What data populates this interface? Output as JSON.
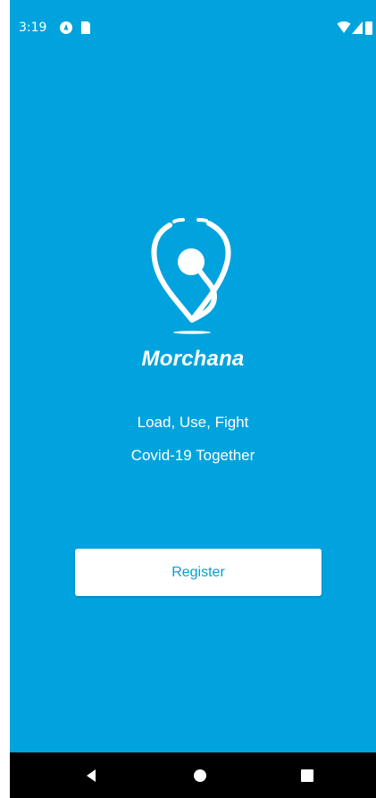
{
  "status": {
    "time": "3:19",
    "icons": [
      "hotspot-icon",
      "sim-card-icon",
      "wifi-icon",
      "signal-icon",
      "battery-icon"
    ]
  },
  "app": {
    "name": "Morchana",
    "tagline_line1": "Load, Use, Fight",
    "tagline_line2": "Covid-19 Together",
    "register_label": "Register"
  },
  "colors": {
    "background": "#00a3dd",
    "button_text": "#009fd6",
    "navbar": "#000000"
  },
  "navigation": {
    "icons": [
      "back-icon",
      "home-icon",
      "recents-icon"
    ]
  }
}
